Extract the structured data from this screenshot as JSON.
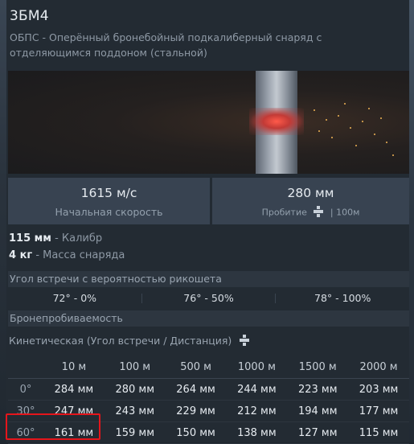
{
  "shell": {
    "title": "3БМ4",
    "description": "ОБПС - Оперённый бронебойный подкалиберный снаряд с отделяющимся поддоном (стальной)"
  },
  "stats": {
    "velocity_value": "1615 м/с",
    "velocity_label": "Начальная скорость",
    "penetration_value": "280 мм",
    "penetration_label": "Пробитие",
    "penetration_suffix": "| 100м"
  },
  "properties": {
    "caliber_value": "115 мм",
    "caliber_label": "- Калибр",
    "mass_value": "4 кг",
    "mass_label": "- Масса снаряда"
  },
  "ricochet": {
    "header": "Угол встречи с вероятностью рикошета",
    "values": [
      "72° - 0%",
      "76° - 50%",
      "78° - 100%"
    ]
  },
  "armor": {
    "header": "Бронепробиваемость",
    "kinetic_label": "Кинетическая (Угол встречи / Дистанция)",
    "distances": [
      "10 м",
      "100 м",
      "500 м",
      "1000 м",
      "1500 м",
      "2000 м"
    ],
    "rows": [
      {
        "angle": "0°",
        "values": [
          "284 мм",
          "280 мм",
          "264 мм",
          "244 мм",
          "223 мм",
          "203 мм"
        ]
      },
      {
        "angle": "30°",
        "values": [
          "247 мм",
          "243 мм",
          "229 мм",
          "212 мм",
          "194 мм",
          "177 мм"
        ]
      },
      {
        "angle": "60°",
        "values": [
          "161 мм",
          "159 мм",
          "150 мм",
          "138 мм",
          "127 мм",
          "115 мм"
        ]
      }
    ]
  },
  "colors": {
    "highlight": "#e5151b",
    "panel": "#232b33",
    "stat_box": "#384351"
  }
}
